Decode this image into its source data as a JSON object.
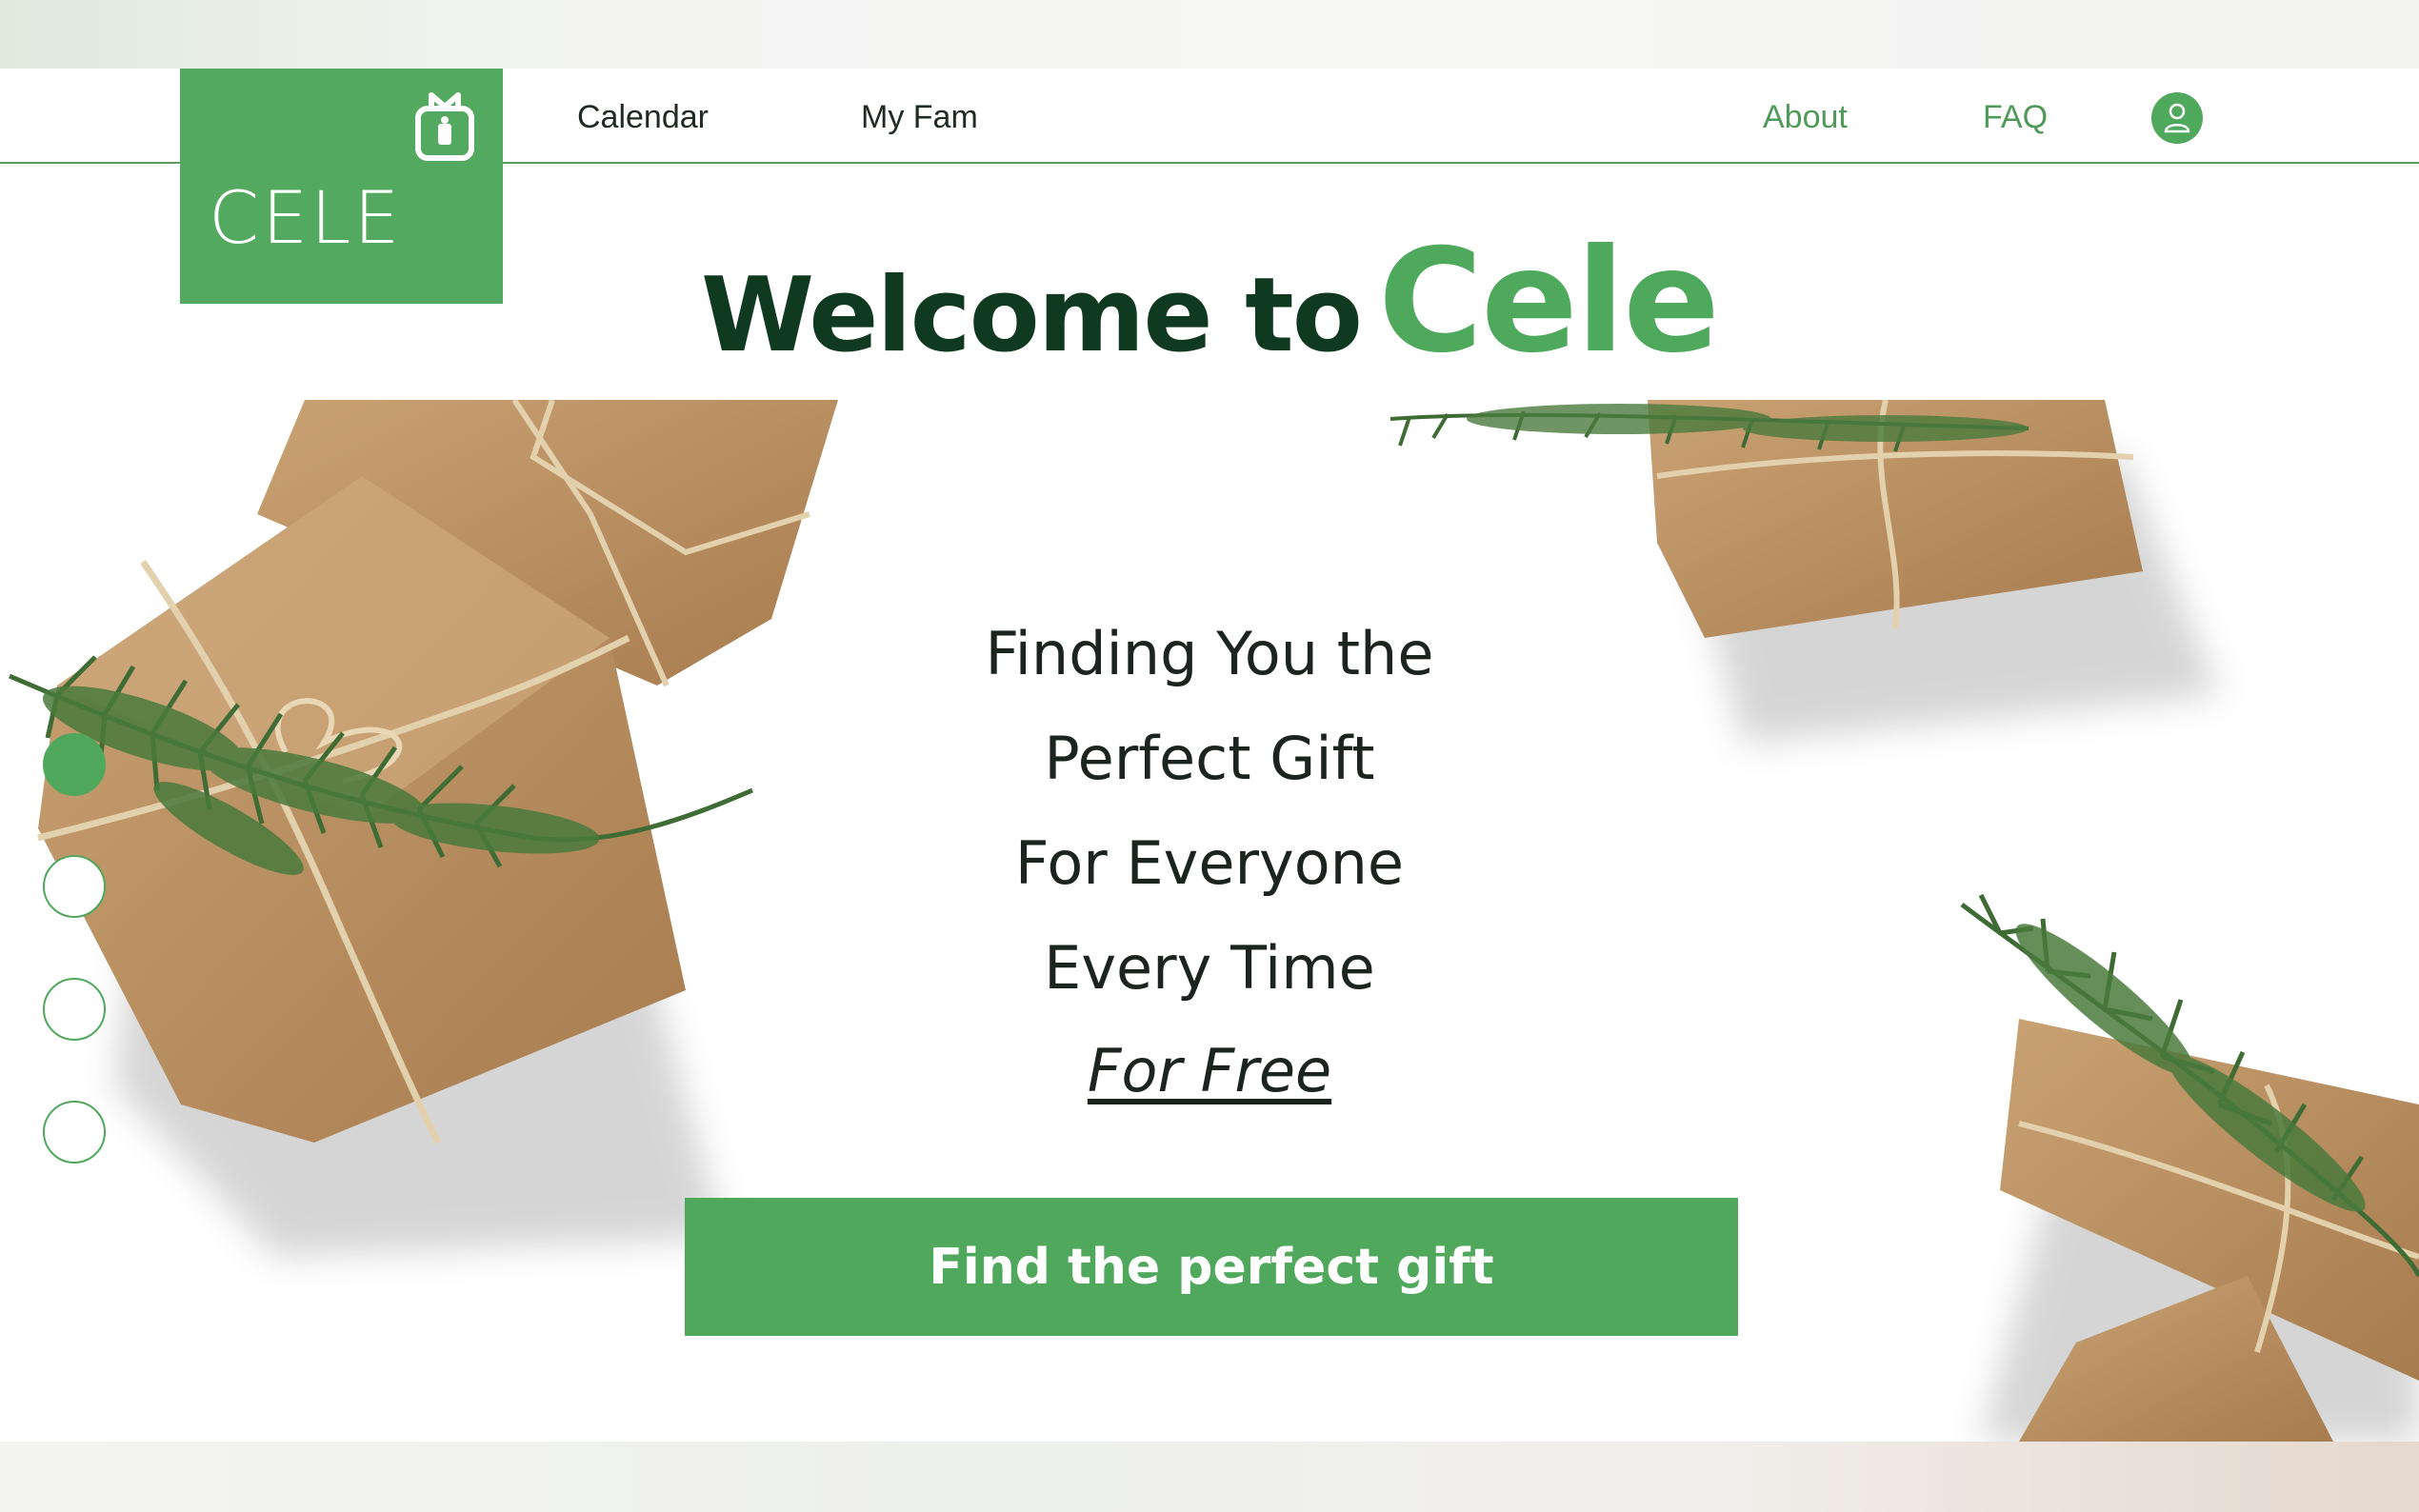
{
  "brand": {
    "logo_text": "CELE",
    "accent": "#53a95f",
    "dark_green": "#0f3a1f"
  },
  "nav": {
    "left_links": [
      {
        "label": "Calendar"
      },
      {
        "label": "My Fam"
      }
    ],
    "right_links": [
      {
        "label": "About"
      },
      {
        "label": "FAQ"
      }
    ],
    "user_icon": "user-icon"
  },
  "headline": {
    "prefix": "Welcome to",
    "brand_name": "Cele"
  },
  "hero": {
    "tagline": [
      "Finding You the",
      "Perfect Gift",
      "For Everyone",
      "Every Time"
    ],
    "tagline_emphasis": "For Free",
    "cta_label": "Find the perfect gift",
    "carousel": {
      "slide_count": 4,
      "active_index": 0
    }
  }
}
